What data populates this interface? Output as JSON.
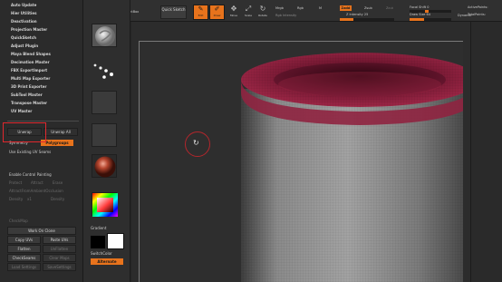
{
  "plugin_menu": {
    "items": [
      "Auto Update",
      "Hier Utilities",
      "Deactivation",
      "Projection Master",
      "QuickSketch",
      "Adjust Plugin",
      "Maya Blend Shapes",
      "Decimation Master",
      "FBX ExportImport",
      "Multi Map Exporter",
      "3D Print Exporter",
      "SubTool Master",
      "Transpose Master",
      "UV Master"
    ]
  },
  "symmetry": {
    "unwrap": "Unwrap",
    "unwrap_all": "Unwrap All",
    "symmetry": "Symmetry",
    "polygroups": "Polygroups",
    "use_existing": "Use Existing UV Seams"
  },
  "panel_lower": {
    "enable_control_painting": "Enable Control Painting",
    "dim_row1": [
      "Protect",
      "Attract",
      "Erase"
    ],
    "dim_row2": "AttractFromAmbientOcclusion",
    "dim_row3": [
      "Density",
      "x1",
      "Density"
    ],
    "flatten_label": "CheckMap",
    "work_on_clone": "Work On Clone",
    "copy_uvs": "Copy UVs",
    "paste_uvs": "Paste UVs",
    "flatten": "Flatten",
    "unflatten": "UnFlatten",
    "check_seams": "CheckSeams",
    "clear_maps": "Clear Maps",
    "load_settings": "Load Settings",
    "save_settings": "SaveSettings"
  },
  "brush_column": {
    "thumb_labels": [
      "",
      "",
      "",
      "",
      ""
    ],
    "gradient_label": "Gradient",
    "switch_color": "SwitchColor",
    "alternate": "Alternate"
  },
  "toolbar": {
    "projection_master": "Projection Master",
    "lightbox": "LightBox",
    "quick_sketch": "Quick Sketch",
    "edit": "Edit",
    "draw": "Draw",
    "move": "Move",
    "scale": "Scale",
    "rotate": "Rotate",
    "mrgb": "Mrgb",
    "rgb": "Rgb",
    "m": "M",
    "rgb_intensity": "Rgb Intensity",
    "zadd": "Zadd",
    "zsub": "Zsub",
    "zcut": "Zcut",
    "z_intensity": "Z Intensity 25",
    "focal_shift": "Focal Shift 0",
    "draw_size": "Draw Size 64",
    "dynamic": "Dynamic",
    "active_points": "ActivePoints:",
    "total_points": "TotalPoints:"
  },
  "colors": {
    "accent": "#e8731c",
    "highlight_red": "#e0272d",
    "mesh_red": "#8a1f3a"
  }
}
